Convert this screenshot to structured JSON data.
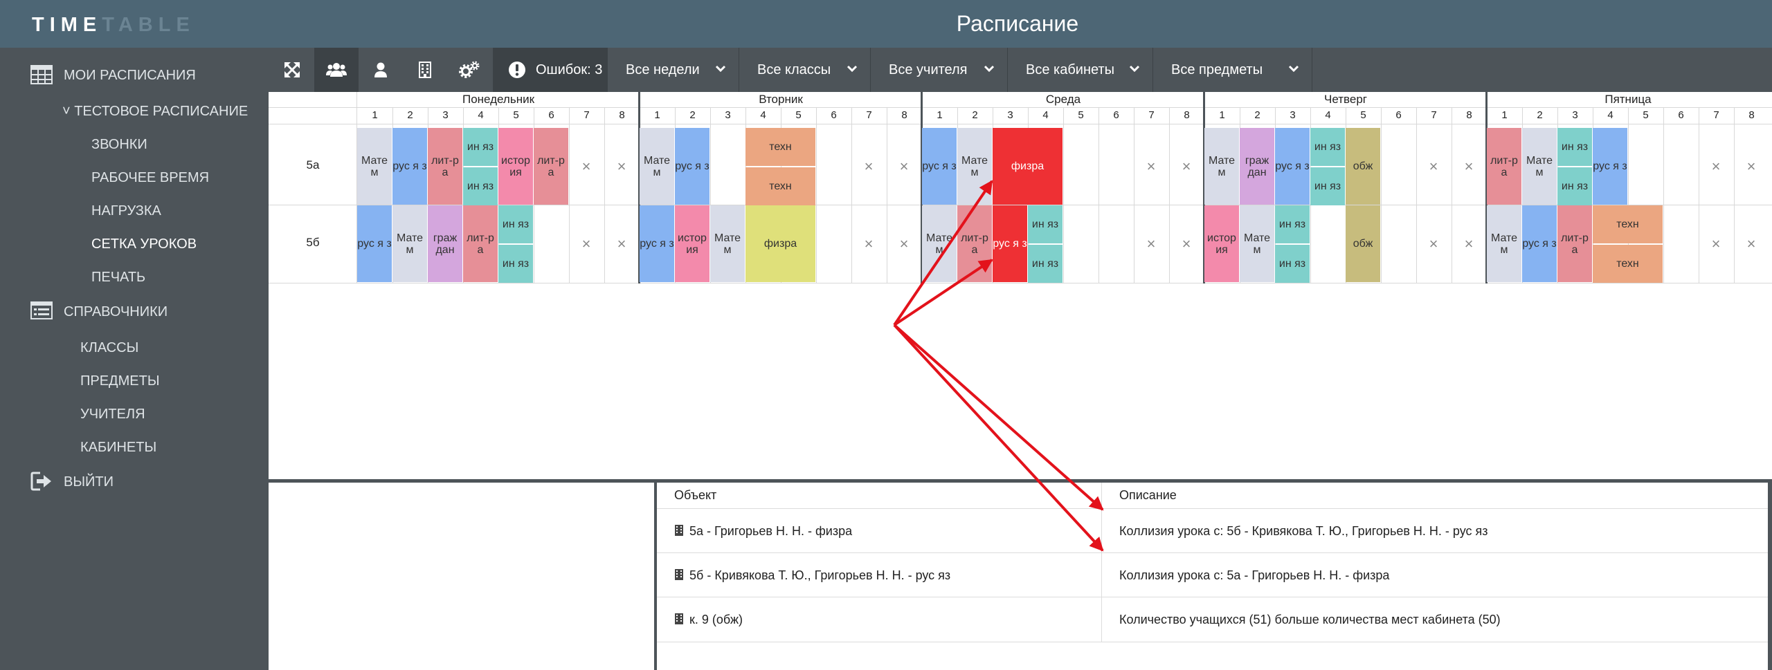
{
  "app": {
    "logo_part1": "TIME",
    "logo_part2": "TABLE",
    "title": "Расписание"
  },
  "sidebar": {
    "my_schedules": "МОИ РАСПИСАНИЯ",
    "test_schedule": "˅ ТЕСТОВОЕ РАСПИСАНИЕ",
    "sub_items": [
      "ЗВОНКИ",
      "РАБОЧЕЕ ВРЕМЯ",
      "НАГРУЗКА",
      "СЕТКА УРОКОВ",
      "ПЕЧАТЬ"
    ],
    "active_item": "СЕТКА УРОКОВ",
    "references": "СПРАВОЧНИКИ",
    "ref_items": [
      "КЛАССЫ",
      "ПРЕДМЕТЫ",
      "УЧИТЕЛЯ",
      "КАБИНЕТЫ"
    ],
    "logout": "ВЫЙТИ"
  },
  "toolbar": {
    "icons": [
      "expand-icon",
      "group-icon",
      "user-icon",
      "building-icon",
      "gears-icon"
    ],
    "selected_icon": "group-icon",
    "errors_label": "Ошибок: 3",
    "filters": [
      "Все недели",
      "Все классы",
      "Все учителя",
      "Все кабинеты",
      "Все предметы"
    ]
  },
  "schedule": {
    "days": [
      "Понедельник",
      "Вторник",
      "Среда",
      "Четверг",
      "Пятница"
    ],
    "lessons": [
      "1",
      "2",
      "3",
      "4",
      "5",
      "6",
      "7",
      "8"
    ],
    "classes": [
      "5а",
      "5б"
    ],
    "empty_mark": "×",
    "cells": [
      {
        "class": "5а",
        "day": "Понедельник",
        "lesson": 1,
        "span": 1,
        "text": "Мате м",
        "color": "#d8dce8"
      },
      {
        "class": "5а",
        "day": "Понедельник",
        "lesson": 2,
        "span": 1,
        "text": "рус я з",
        "color": "#86b3f2"
      },
      {
        "class": "5а",
        "day": "Понедельник",
        "lesson": 3,
        "span": 1,
        "text": "лит-р а",
        "color": "#e68f97"
      },
      {
        "class": "5а",
        "day": "Понедельник",
        "lesson": 4,
        "span": 1,
        "half": "top",
        "text": "ин яз",
        "color": "#7fd0cb"
      },
      {
        "class": "5а",
        "day": "Понедельник",
        "lesson": 4,
        "span": 1,
        "half": "bottom",
        "text": "ин яз",
        "color": "#7fd0cb"
      },
      {
        "class": "5а",
        "day": "Понедельник",
        "lesson": 5,
        "span": 1,
        "text": "истор ия",
        "color": "#f38aab"
      },
      {
        "class": "5а",
        "day": "Понедельник",
        "lesson": 6,
        "span": 1,
        "text": "лит-р а",
        "color": "#e68f97"
      },
      {
        "class": "5а",
        "day": "Вторник",
        "lesson": 1,
        "span": 1,
        "text": "Мате м",
        "color": "#d8dce8"
      },
      {
        "class": "5а",
        "day": "Вторник",
        "lesson": 2,
        "span": 1,
        "text": "рус я з",
        "color": "#86b3f2"
      },
      {
        "class": "5а",
        "day": "Вторник",
        "lesson": 4,
        "span": 2,
        "half": "top",
        "text": "техн",
        "color": "#eba681"
      },
      {
        "class": "5а",
        "day": "Вторник",
        "lesson": 4,
        "span": 2,
        "half": "bottom",
        "text": "техн",
        "color": "#eba681"
      },
      {
        "class": "5а",
        "day": "Среда",
        "lesson": 1,
        "span": 1,
        "text": "рус я з",
        "color": "#86b3f2"
      },
      {
        "class": "5а",
        "day": "Среда",
        "lesson": 2,
        "span": 1,
        "text": "Мате м",
        "color": "#d8dce8"
      },
      {
        "class": "5а",
        "day": "Среда",
        "lesson": 3,
        "span": 2,
        "text": "физра",
        "color": "#ee3034",
        "conflict": true
      },
      {
        "class": "5а",
        "day": "Четверг",
        "lesson": 1,
        "span": 1,
        "text": "Мате м",
        "color": "#d8dce8"
      },
      {
        "class": "5а",
        "day": "Четверг",
        "lesson": 2,
        "span": 1,
        "text": "граж дан",
        "color": "#d4a6dd"
      },
      {
        "class": "5а",
        "day": "Четверг",
        "lesson": 3,
        "span": 1,
        "text": "рус я з",
        "color": "#86b3f2"
      },
      {
        "class": "5а",
        "day": "Четверг",
        "lesson": 4,
        "span": 1,
        "half": "top",
        "text": "ин яз",
        "color": "#7fd0cb"
      },
      {
        "class": "5а",
        "day": "Четверг",
        "lesson": 4,
        "span": 1,
        "half": "bottom",
        "text": "ин яз",
        "color": "#7fd0cb"
      },
      {
        "class": "5а",
        "day": "Четверг",
        "lesson": 5,
        "span": 1,
        "text": "обж",
        "color": "#c7bc7d"
      },
      {
        "class": "5а",
        "day": "Пятница",
        "lesson": 1,
        "span": 1,
        "text": "лит-р а",
        "color": "#e68f97"
      },
      {
        "class": "5а",
        "day": "Пятница",
        "lesson": 2,
        "span": 1,
        "text": "Мате м",
        "color": "#d8dce8"
      },
      {
        "class": "5а",
        "day": "Пятница",
        "lesson": 3,
        "span": 1,
        "half": "top",
        "text": "ин яз",
        "color": "#7fd0cb"
      },
      {
        "class": "5а",
        "day": "Пятница",
        "lesson": 3,
        "span": 1,
        "half": "bottom",
        "text": "ин яз",
        "color": "#7fd0cb"
      },
      {
        "class": "5а",
        "day": "Пятница",
        "lesson": 4,
        "span": 1,
        "text": "рус я з",
        "color": "#86b3f2"
      },
      {
        "class": "5б",
        "day": "Понедельник",
        "lesson": 1,
        "span": 1,
        "text": "рус я з",
        "color": "#86b3f2"
      },
      {
        "class": "5б",
        "day": "Понедельник",
        "lesson": 2,
        "span": 1,
        "text": "Мате м",
        "color": "#d8dce8"
      },
      {
        "class": "5б",
        "day": "Понедельник",
        "lesson": 3,
        "span": 1,
        "text": "граж дан",
        "color": "#d4a6dd"
      },
      {
        "class": "5б",
        "day": "Понедельник",
        "lesson": 4,
        "span": 1,
        "text": "лит-р а",
        "color": "#e68f97"
      },
      {
        "class": "5б",
        "day": "Понедельник",
        "lesson": 5,
        "span": 1,
        "half": "top",
        "text": "ин яз",
        "color": "#7fd0cb"
      },
      {
        "class": "5б",
        "day": "Понедельник",
        "lesson": 5,
        "span": 1,
        "half": "bottom",
        "text": "ин яз",
        "color": "#7fd0cb"
      },
      {
        "class": "5б",
        "day": "Вторник",
        "lesson": 1,
        "span": 1,
        "text": "рус я з",
        "color": "#86b3f2"
      },
      {
        "class": "5б",
        "day": "Вторник",
        "lesson": 2,
        "span": 1,
        "text": "истор ия",
        "color": "#f38aab"
      },
      {
        "class": "5б",
        "day": "Вторник",
        "lesson": 3,
        "span": 1,
        "text": "Мате м",
        "color": "#d8dce8"
      },
      {
        "class": "5б",
        "day": "Вторник",
        "lesson": 4,
        "span": 2,
        "text": "физра",
        "color": "#dfe07a"
      },
      {
        "class": "5б",
        "day": "Среда",
        "lesson": 1,
        "span": 1,
        "text": "Мате м",
        "color": "#d8dce8"
      },
      {
        "class": "5б",
        "day": "Среда",
        "lesson": 2,
        "span": 1,
        "text": "лит-р а",
        "color": "#e68f97"
      },
      {
        "class": "5б",
        "day": "Среда",
        "lesson": 3,
        "span": 1,
        "text": "рус я з",
        "color": "#ee3034",
        "conflict": true
      },
      {
        "class": "5б",
        "day": "Среда",
        "lesson": 4,
        "span": 1,
        "half": "top",
        "text": "ин яз",
        "color": "#7fd0cb"
      },
      {
        "class": "5б",
        "day": "Среда",
        "lesson": 4,
        "span": 1,
        "half": "bottom",
        "text": "ин яз",
        "color": "#7fd0cb"
      },
      {
        "class": "5б",
        "day": "Четверг",
        "lesson": 1,
        "span": 1,
        "text": "истор ия",
        "color": "#f38aab"
      },
      {
        "class": "5б",
        "day": "Четверг",
        "lesson": 2,
        "span": 1,
        "text": "Мате м",
        "color": "#d8dce8"
      },
      {
        "class": "5б",
        "day": "Четверг",
        "lesson": 3,
        "span": 1,
        "half": "top",
        "text": "ин яз",
        "color": "#7fd0cb"
      },
      {
        "class": "5б",
        "day": "Четверг",
        "lesson": 3,
        "span": 1,
        "half": "bottom",
        "text": "ин яз",
        "color": "#7fd0cb"
      },
      {
        "class": "5б",
        "day": "Четверг",
        "lesson": 5,
        "span": 1,
        "text": "обж",
        "color": "#c7bc7d"
      },
      {
        "class": "5б",
        "day": "Пятница",
        "lesson": 1,
        "span": 1,
        "text": "Мате м",
        "color": "#d8dce8"
      },
      {
        "class": "5б",
        "day": "Пятница",
        "lesson": 2,
        "span": 1,
        "text": "рус я з",
        "color": "#86b3f2"
      },
      {
        "class": "5б",
        "day": "Пятница",
        "lesson": 3,
        "span": 1,
        "text": "лит-р а",
        "color": "#e68f97"
      },
      {
        "class": "5б",
        "day": "Пятница",
        "lesson": 4,
        "span": 2,
        "half": "top",
        "text": "техн",
        "color": "#eba681"
      },
      {
        "class": "5б",
        "day": "Пятница",
        "lesson": 4,
        "span": 2,
        "half": "bottom",
        "text": "техн",
        "color": "#eba681"
      }
    ],
    "x_marks": [
      {
        "class": "5а",
        "day": "Понедельник",
        "lessons": [
          7,
          8
        ]
      },
      {
        "class": "5а",
        "day": "Вторник",
        "lessons": [
          7,
          8
        ]
      },
      {
        "class": "5а",
        "day": "Среда",
        "lessons": [
          7,
          8
        ]
      },
      {
        "class": "5а",
        "day": "Четверг",
        "lessons": [
          7,
          8
        ]
      },
      {
        "class": "5а",
        "day": "Пятница",
        "lessons": [
          7,
          8
        ]
      },
      {
        "class": "5б",
        "day": "Понедельник",
        "lessons": [
          7,
          8
        ]
      },
      {
        "class": "5б",
        "day": "Вторник",
        "lessons": [
          7,
          8
        ]
      },
      {
        "class": "5б",
        "day": "Среда",
        "lessons": [
          7,
          8
        ]
      },
      {
        "class": "5б",
        "day": "Четверг",
        "lessons": [
          7,
          8
        ]
      },
      {
        "class": "5б",
        "day": "Пятница",
        "lessons": [
          7,
          8
        ]
      }
    ]
  },
  "errors": {
    "col_object": "Объект",
    "col_description": "Описание",
    "rows": [
      {
        "icon": "building-icon",
        "object": "5а - Григорьев Н. Н. - физра",
        "description": "Коллизия урока с: 5б - Кривякова Т. Ю., Григорьев Н. Н. - рус яз"
      },
      {
        "icon": "building-icon",
        "object": "5б - Кривякова Т. Ю., Григорьев Н. Н. - рус яз",
        "description": "Коллизия урока с: 5а - Григорьев Н. Н. - физра"
      },
      {
        "icon": "building-icon",
        "object": "к. 9 (обж)",
        "description": "Количество учащихся (51) больше количества мест кабинета (50)"
      }
    ]
  },
  "colors": {
    "topbar": "#4d6675",
    "sidebar": "#4d5459",
    "conflict": "#ee3034",
    "arrow": "#e3121b"
  }
}
